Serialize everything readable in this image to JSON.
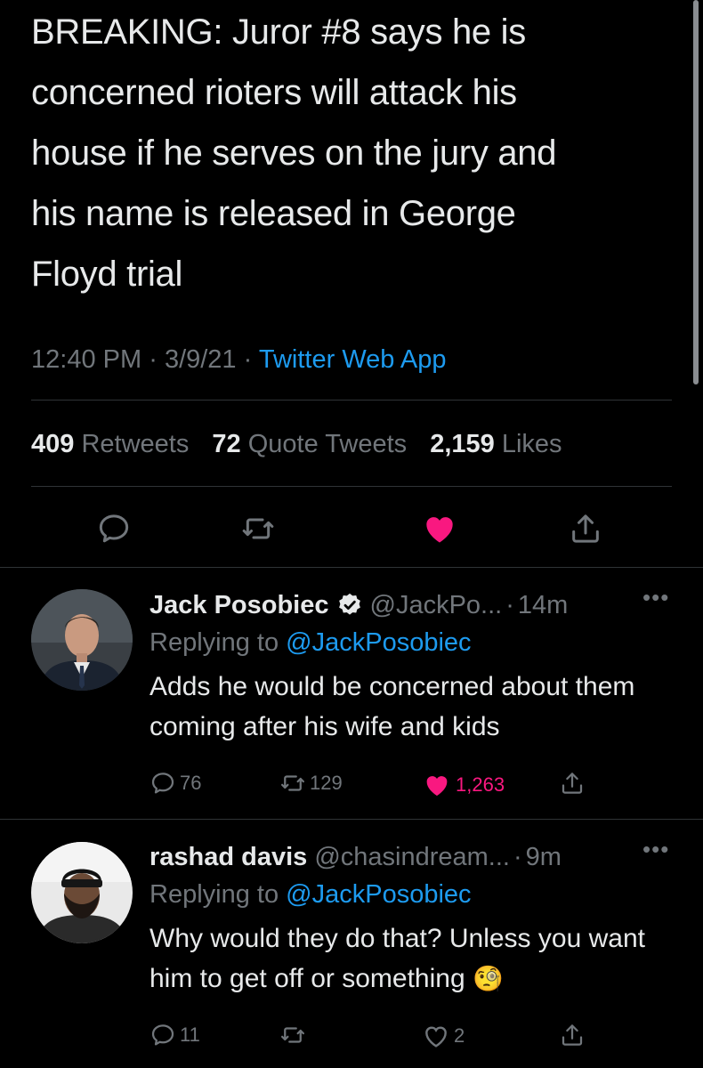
{
  "tweet": {
    "lines": [
      "BREAKING: Juror #8 says he is",
      "concerned rioters will attack his",
      "house if he serves on the jury and",
      "his name is released in George",
      "Floyd trial"
    ],
    "time": "12:40 PM",
    "date": "3/9/21",
    "source": "Twitter Web App",
    "sep": "·",
    "stats": {
      "retweets_count": "409",
      "retweets_label": "Retweets",
      "quotes_count": "72",
      "quotes_label": "Quote Tweets",
      "likes_count": "2,159",
      "likes_label": "Likes"
    },
    "actions": [
      "reply-icon",
      "retweet-icon",
      "like-icon",
      "share-icon"
    ],
    "liked": true
  },
  "replies": [
    {
      "name": "Jack Posobiec",
      "verified": true,
      "handle": "@JackPo...",
      "time": "14m",
      "replying_label": "Replying to",
      "replying_to": "@JackPosobiec",
      "text": "Adds he would be concerned about them coming after his wife and kids",
      "reply_count": "76",
      "retweet_count": "129",
      "like_count": "1,263",
      "liked": true
    },
    {
      "name": "rashad davis",
      "verified": false,
      "handle": "@chasindream...",
      "time": "9m",
      "replying_label": "Replying to",
      "replying_to": "@JackPosobiec",
      "text": "Why would they do that? Unless you want him to get off or something",
      "emoji": "🧐",
      "reply_count": "11",
      "retweet_count": "",
      "like_count": "2",
      "liked": false
    }
  ],
  "colors": {
    "background": "#000000",
    "text": "#e7e9ea",
    "muted": "#71767b",
    "link": "#1d9bf0",
    "like": "#f91880",
    "divider": "#2f3336"
  }
}
